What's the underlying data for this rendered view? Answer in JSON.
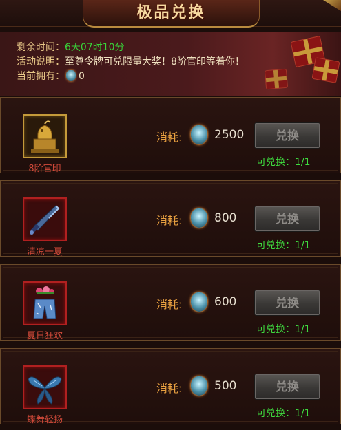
{
  "header": {
    "title": "极品兑换"
  },
  "info": {
    "remaining_label": "剩余时间：",
    "remaining_value": "6天07时10分",
    "desc_label": "活动说明：",
    "desc_value": "至尊令牌可兑限量大奖！8阶官印等着你！",
    "owned_label": "当前拥有：",
    "owned_value": "0"
  },
  "items": [
    {
      "name": "8阶官印",
      "consume_label": "消耗:",
      "cost": "2500",
      "button": "兑换",
      "avail": "可兑换：1/1"
    },
    {
      "name": "清凉一夏",
      "consume_label": "消耗:",
      "cost": "800",
      "button": "兑换",
      "avail": "可兑换：1/1"
    },
    {
      "name": "夏日狂欢",
      "consume_label": "消耗:",
      "cost": "600",
      "button": "兑换",
      "avail": "可兑换：1/1"
    },
    {
      "name": "蝶舞轻扬",
      "consume_label": "消耗:",
      "cost": "500",
      "button": "兑换",
      "avail": "可兑换：1/1"
    }
  ],
  "icons": {
    "token": "token-icon",
    "seal": "seal-icon",
    "sword": "sword-icon",
    "shorts": "shorts-icon",
    "wings": "wings-icon"
  },
  "colors": {
    "accent_gold": "#f6d9a0",
    "green_text": "#3fdc3f",
    "red_name": "#d24a3a"
  }
}
